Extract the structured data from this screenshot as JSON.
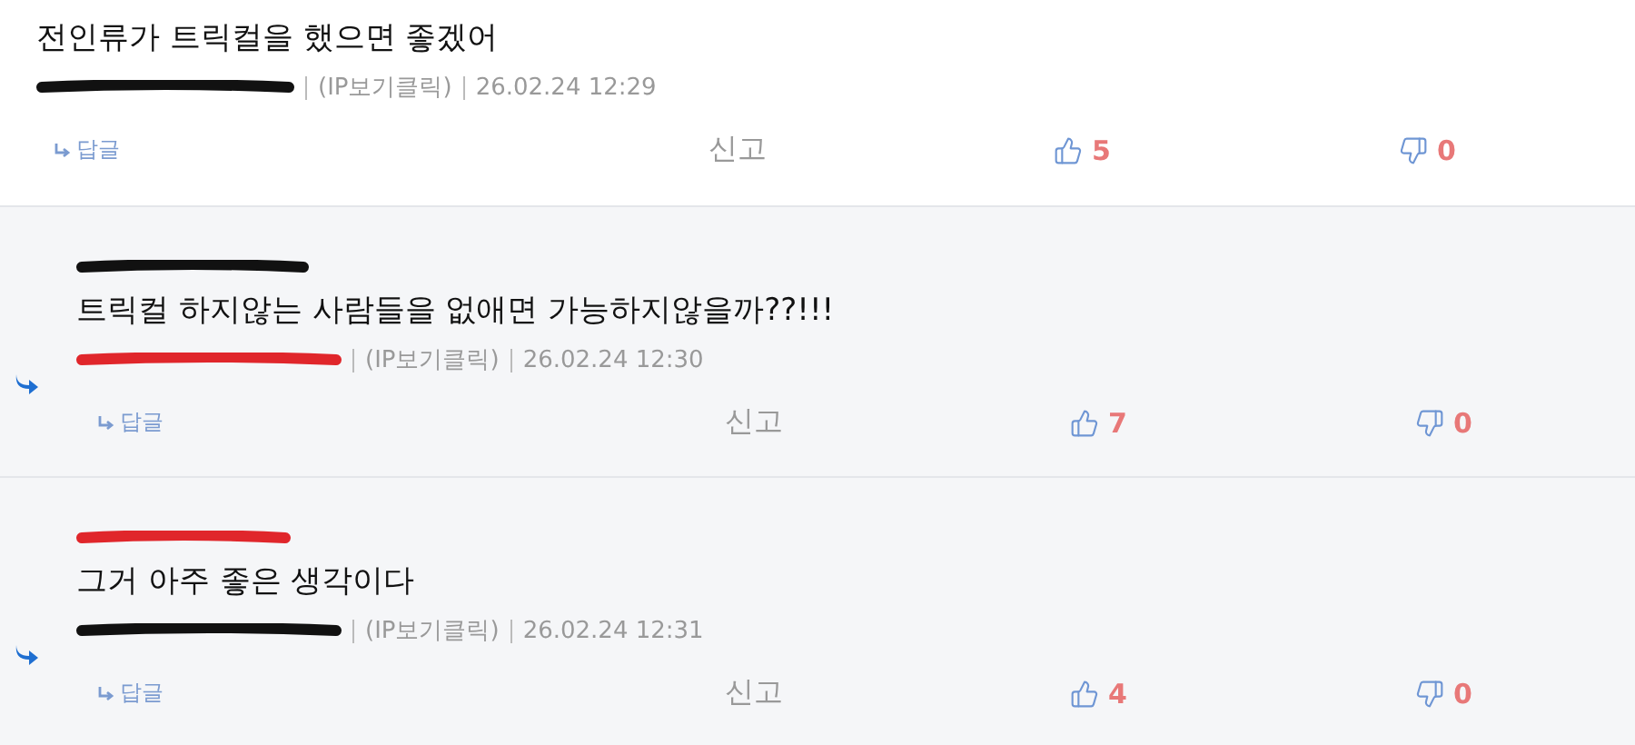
{
  "comments": [
    {
      "kind": "comment",
      "text": "전인류가 트릭컬을 했으면 좋겠어",
      "author": {
        "color": "#111111"
      },
      "ip": "(IP보기클릭)",
      "date": "26.02.24 12:29",
      "reply_label": "답글",
      "report_label": "신고",
      "likes": "5",
      "dislikes": "0"
    },
    {
      "kind": "reply",
      "mention": {
        "color": "#111111"
      },
      "text": "트릭컬 하지않는 사람들을 없애면 가능하지않을까??!!!",
      "author": {
        "color": "#e0262b"
      },
      "ip": "(IP보기클릭)",
      "date": "26.02.24 12:30",
      "reply_label": "답글",
      "report_label": "신고",
      "likes": "7",
      "dislikes": "0"
    },
    {
      "kind": "reply",
      "mention": {
        "color": "#e0262b"
      },
      "text": "그거 아주 좋은 생각이다",
      "author": {
        "color": "#111111"
      },
      "ip": "(IP보기클릭)",
      "date": "26.02.24 12:31",
      "reply_label": "답글",
      "report_label": "신고",
      "likes": "4",
      "dislikes": "0"
    }
  ]
}
